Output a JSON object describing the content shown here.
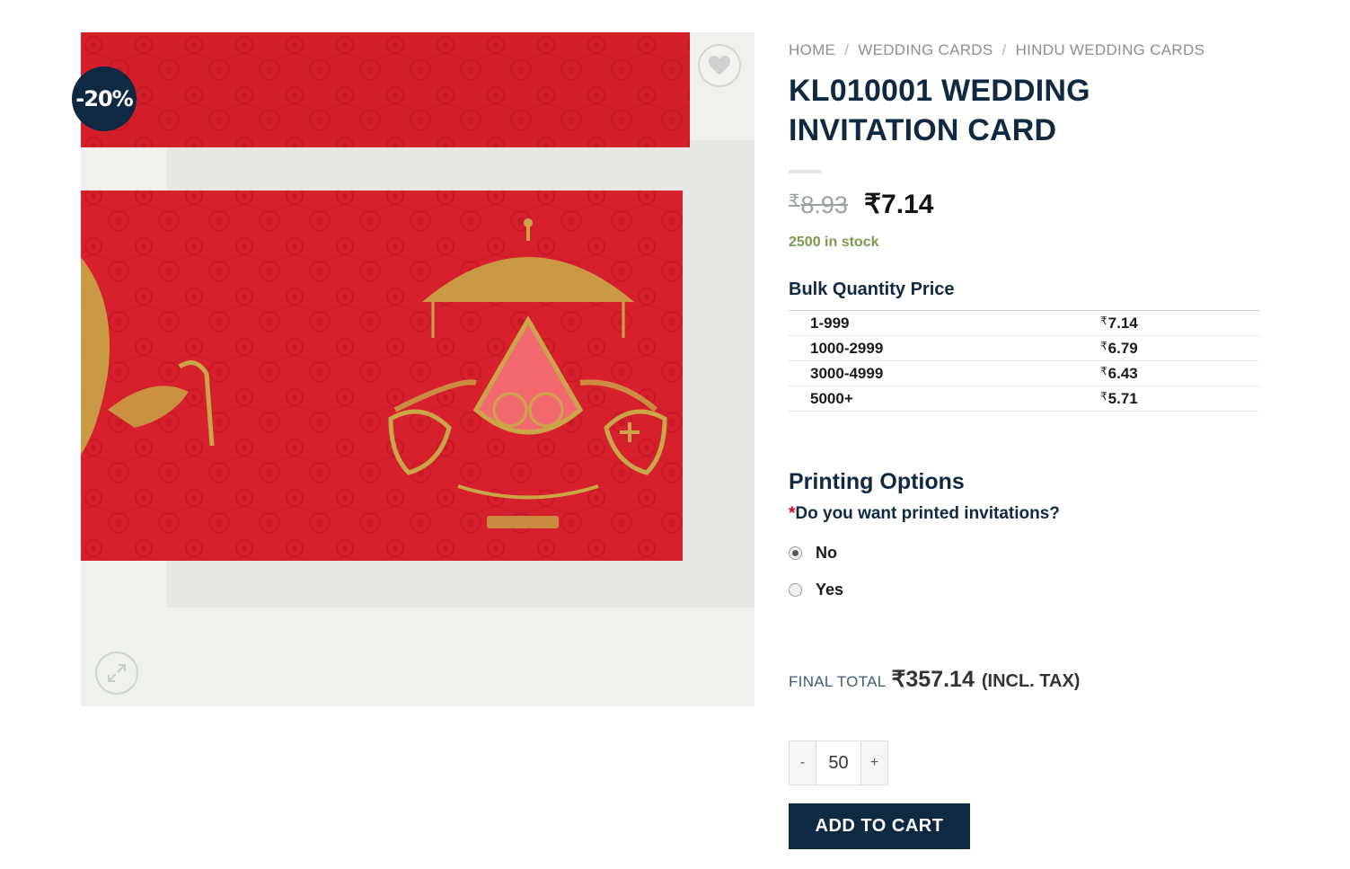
{
  "gallery": {
    "sale_badge": "-20%",
    "wishlist_icon": "heart-icon",
    "zoom_icon": "expand-icon",
    "image_alt": "KL010001 Wedding Invitation Card",
    "card_colors": {
      "red": "#d21f2a",
      "gold": "#c9a648",
      "background": "#eef1ec"
    }
  },
  "breadcrumb": {
    "items": [
      "HOME",
      "WEDDING CARDS",
      "HINDU WEDDING CARDS"
    ],
    "separator": "/"
  },
  "product": {
    "title": "KL010001 WEDDING INVITATION CARD",
    "currency": "₹",
    "old_price": "8.93",
    "price": "7.14",
    "stock": "2500 in stock"
  },
  "bulk": {
    "heading": "Bulk Quantity Price",
    "rows": [
      {
        "qty": "1-999",
        "price": "7.14"
      },
      {
        "qty": "1000-2999",
        "price": "6.79"
      },
      {
        "qty": "3000-4999",
        "price": "6.43"
      },
      {
        "qty": "5000+",
        "price": "5.71"
      }
    ]
  },
  "printing": {
    "heading": "Printing Options",
    "required_mark": "*",
    "question": "Do you want printed invitations?",
    "options": [
      {
        "label": "No",
        "checked": true
      },
      {
        "label": "Yes",
        "checked": false
      }
    ]
  },
  "total": {
    "label": "FINAL TOTAL",
    "value": "₹357.14",
    "tax_note": "(INCL. TAX)"
  },
  "cart": {
    "minus": "-",
    "plus": "+",
    "quantity": "50",
    "add_label": "ADD TO CART"
  },
  "colors": {
    "navy": "#0e2a42",
    "stock_green": "#7a9a4e",
    "required_red": "#d0021b"
  }
}
